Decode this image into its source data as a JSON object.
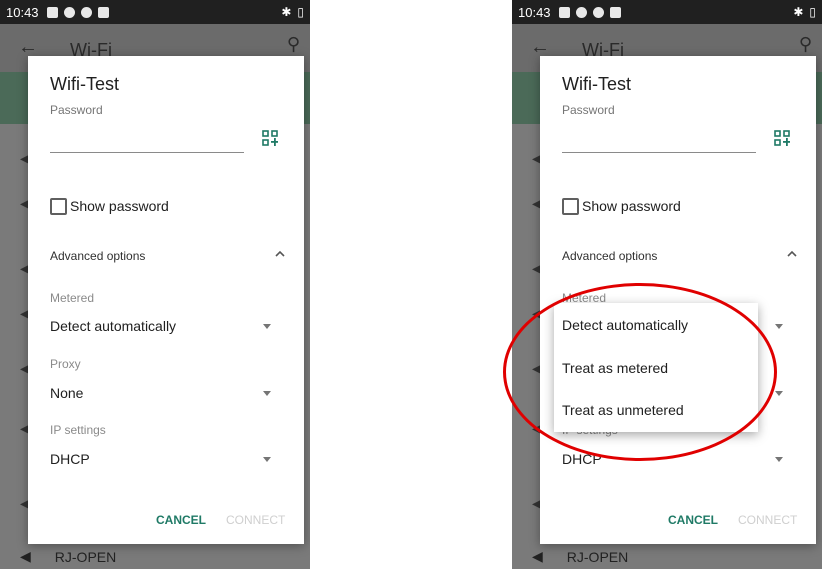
{
  "status_bar": {
    "time": "10:43"
  },
  "app_bar": {
    "back_glyph": "←",
    "title": "Wi-Fi",
    "search_glyph": "⚲"
  },
  "background": {
    "network_name": "RJ-OPEN"
  },
  "dialog": {
    "title": "Wifi-Test",
    "password_label": "Password",
    "show_password_label": "Show password",
    "advanced_label": "Advanced options",
    "metered_label": "Metered",
    "metered_value": "Detect automatically",
    "proxy_label": "Proxy",
    "proxy_value": "None",
    "ip_label": "IP settings",
    "ip_value": "DHCP",
    "cancel_label": "CANCEL",
    "connect_label": "CONNECT"
  },
  "dropdown_menu": {
    "options": [
      "Detect automatically",
      "Treat as metered",
      "Treat as unmetered"
    ]
  },
  "colors": {
    "accent": "#1f7a66",
    "highlight": "#e00000"
  },
  "icons": [
    "back-arrow-icon",
    "search-icon",
    "qr-code-icon",
    "chevron-up-icon",
    "dropdown-caret-icon",
    "wifi-icon"
  ]
}
